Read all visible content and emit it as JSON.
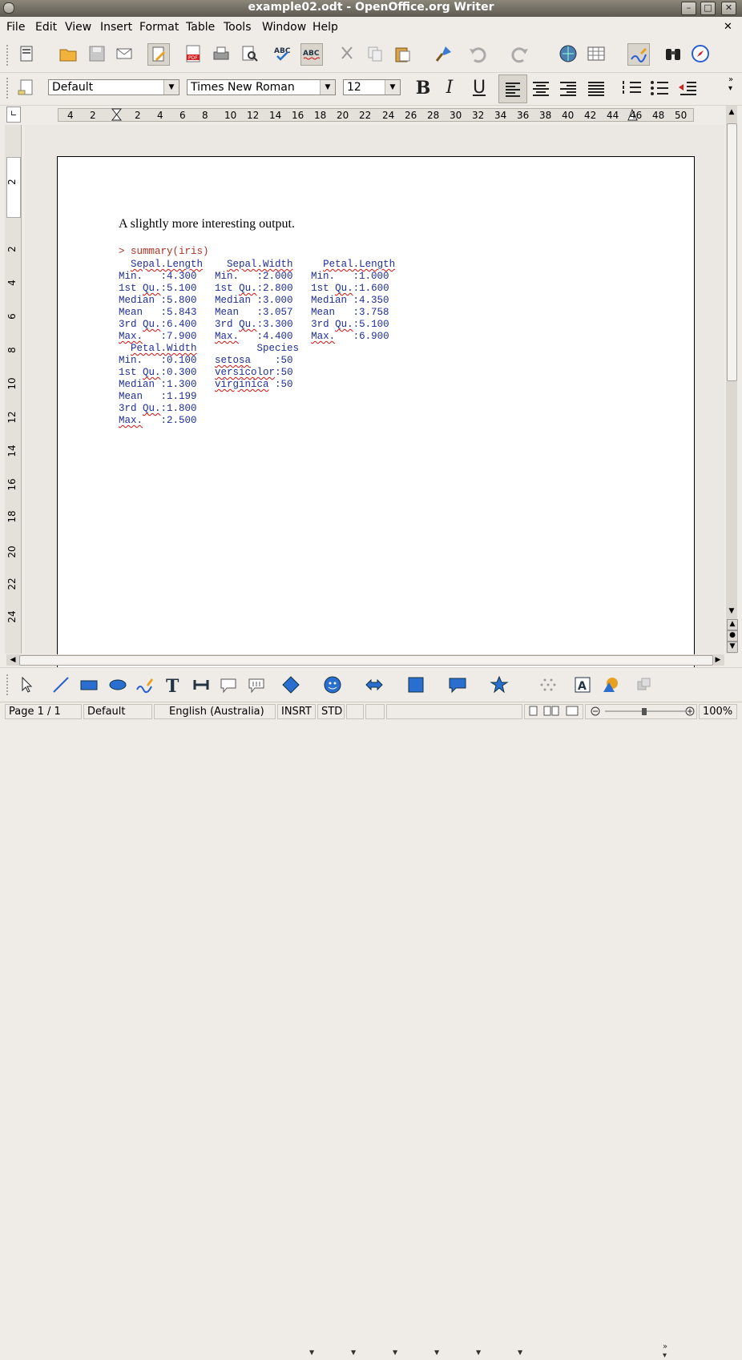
{
  "window": {
    "title": "example02.odt - OpenOffice.org Writer"
  },
  "menu": [
    "File",
    "Edit",
    "View",
    "Insert",
    "Format",
    "Table",
    "Tools",
    "Window",
    "Help"
  ],
  "formatting": {
    "paragraph_style": "Default",
    "font_name": "Times New Roman",
    "font_size": "12"
  },
  "ruler": {
    "labels": [
      "4",
      "2",
      "2",
      "4",
      "6",
      "8",
      "10",
      "12",
      "14",
      "16",
      "18",
      "20",
      "22",
      "24",
      "26",
      "28",
      "30",
      "32",
      "34",
      "36",
      "38",
      "40",
      "42",
      "44",
      "46",
      "48",
      "50"
    ]
  },
  "vruler": {
    "labels": [
      "2",
      "2",
      "4",
      "6",
      "8",
      "10",
      "12",
      "14",
      "16",
      "18",
      "20",
      "22",
      "24"
    ]
  },
  "document": {
    "heading": "A slightly more interesting output.",
    "command": "> summary(iris)",
    "output_lines": [
      "  Sepal.Length    Sepal.Width     Petal.Length",
      "Min.   :4.300   Min.   :2.000   Min.   :1.000",
      "1st Qu.:5.100   1st Qu.:2.800   1st Qu.:1.600",
      "Median :5.800   Median :3.000   Median :4.350",
      "Mean   :5.843   Mean   :3.057   Mean   :3.758",
      "3rd Qu.:6.400   3rd Qu.:3.300   3rd Qu.:5.100",
      "Max.   :7.900   Max.   :4.400   Max.   :6.900",
      "  Petal.Width          Species",
      "Min.   :0.100   setosa    :50",
      "1st Qu.:0.300   versicolor:50",
      "Median :1.300   virginica :50",
      "Mean   :1.199",
      "3rd Qu.:1.800",
      "Max.   :2.500"
    ]
  },
  "status": {
    "page": "Page 1 / 1",
    "page_style": "Default",
    "language": "English (Australia)",
    "insert_mode": "INSRT",
    "selection_mode": "STD",
    "zoom": "100%"
  },
  "colors": {
    "code_text": "#1e2e9a",
    "prompt_text": "#b03020",
    "spell_underline": "#d01010"
  }
}
